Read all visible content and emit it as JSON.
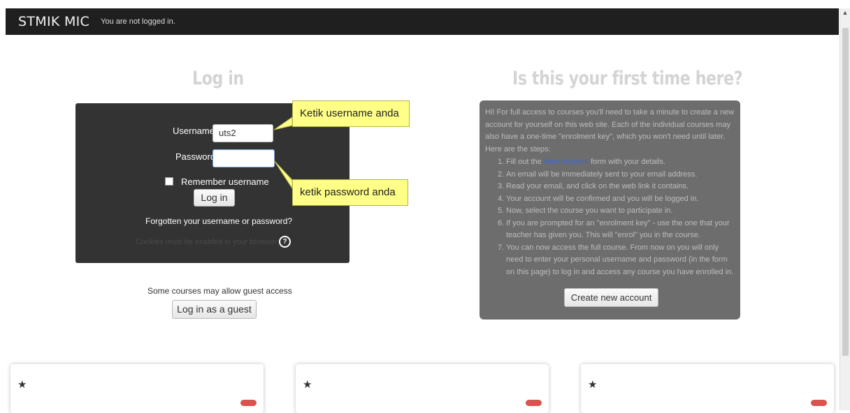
{
  "navbar": {
    "brand": "STMIK MIC",
    "login_status": "You are not logged in."
  },
  "login": {
    "heading": "Log in",
    "username_label": "Username",
    "username_value": "uts2",
    "password_label": "Password",
    "password_value": "",
    "remember_label": "Remember username",
    "remember_checked": false,
    "login_button": "Log in",
    "forgot_link": "Forgotten your username or password?",
    "cookies_notice": "Cookies must be enabled in your browser",
    "help_icon": "?"
  },
  "callouts": {
    "username_hint": "Ketik username anda",
    "password_hint": "ketik password anda",
    "color": "#ffff88"
  },
  "guest": {
    "text": "Some courses may allow guest access",
    "button": "Log in as a guest"
  },
  "signup": {
    "heading": "Is this your first time here?",
    "intro": "Hi! For full access to courses you'll need to take a minute to create a new account for yourself on this web site. Each of the individual courses may also have a one-time \"enrolment key\", which you won't need until later. Here are the steps:",
    "step1_prefix": "Fill out the ",
    "step1_link": "New Account",
    "step1_suffix": " form with your details.",
    "steps": [
      "An email will be immediately sent to your email address.",
      "Read your email, and click on the web link it contains.",
      "Your account will be confirmed and you will be logged in.",
      "Now, select the course you want to participate in.",
      "If you are prompted for an \"enrolment key\" - use the one that your teacher has given you. This will \"enrol\" you in the course.",
      "You can now access the full course. From now on you will only need to enter your personal username and password (in the form on this page) to log in and access any course you have enrolled in."
    ],
    "step_numbers": [
      "1.",
      "2.",
      "3.",
      "4.",
      "5.",
      "6.",
      "7."
    ],
    "create_button": "Create new account"
  },
  "cards": [
    {
      "icon": "star-icon",
      "badge_color": "#d9534f"
    },
    {
      "icon": "star-icon",
      "badge_color": "#d9534f"
    },
    {
      "icon": "star-icon",
      "badge_color": "#d9534f"
    }
  ]
}
